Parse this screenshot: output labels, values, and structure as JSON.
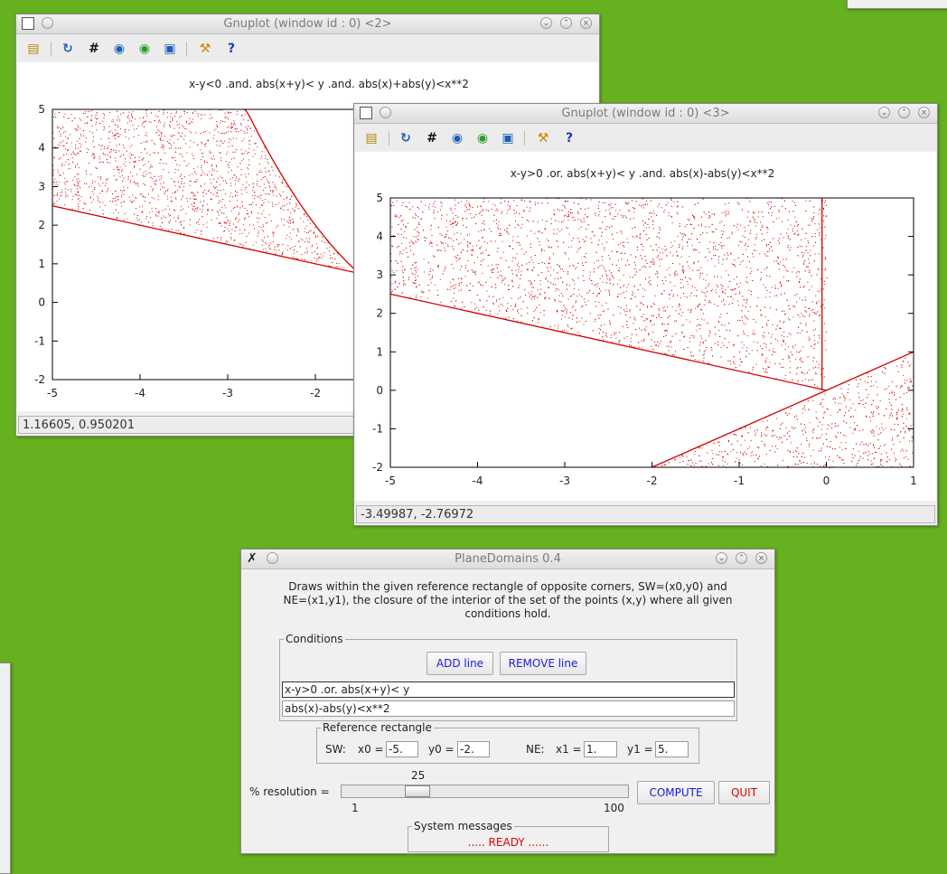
{
  "window1": {
    "title": "Gnuplot (window id : 0) <2>",
    "plot_title": "x-y<0 .and. abs(x+y)< y .and. abs(x)+abs(y)<x**2",
    "status": "1.16605,  0.950201",
    "icons": [
      "copy-to-clipboard-icon",
      "replot-icon",
      "grid-icon",
      "zoom-prev-icon",
      "zoom-next-icon",
      "autoscale-icon",
      "config-icon",
      "help-icon"
    ]
  },
  "window2": {
    "title": "Gnuplot (window id : 0) <3>",
    "plot_title": "x-y>0 .or. abs(x+y)< y .and. abs(x)-abs(y)<x**2",
    "status": "-3.49987, -2.76972"
  },
  "chart_data": [
    {
      "type": "scatter",
      "title": "x-y<0 .and. abs(x+y)< y .and. abs(x)+abs(y)<x**2",
      "xlim": [
        -5,
        1
      ],
      "ylim": [
        -2,
        5
      ],
      "x_ticks_visible": [
        "-5",
        "-4",
        "-3",
        "-2"
      ],
      "y_ticks": [
        "5",
        "4",
        "3",
        "2",
        "1",
        "0",
        "-1",
        "-2"
      ],
      "color": "#d40000",
      "region": "y > -x/3 + 2.5/3*... bounded above by curve; filled random points",
      "series": [
        {
          "values": []
        }
      ]
    },
    {
      "type": "scatter",
      "title": "x-y>0 .or. abs(x+y)< y .and. abs(x)-abs(y)<x**2",
      "xlim": [
        -5,
        1
      ],
      "ylim": [
        -2,
        5
      ],
      "x_ticks": [
        "-5",
        "-4",
        "-3",
        "-2",
        "-1",
        "0",
        "1"
      ],
      "y_ticks": [
        "5",
        "4",
        "3",
        "2",
        "1",
        "0",
        "-1",
        "-2"
      ],
      "color": "#d40000"
    }
  ],
  "planedomains": {
    "title": "PlaneDomains 0.4",
    "description": [
      "Draws within the given reference rectangle of opposite corners,  SW=(x0,y0) and",
      "NE=(x1,y1), the closure of the interior of the set of the points (x,y) where all given",
      "conditions hold."
    ],
    "conditions_label": "Conditions",
    "add_line": "ADD line",
    "remove_line": "REMOVE line",
    "condition1": "x-y>0 .or. abs(x+y)< y",
    "condition2": "abs(x)-abs(y)<x**2",
    "ref_label": "Reference rectangle",
    "sw_label": "SW:",
    "x0_label": "x0 =",
    "x0": "-5.",
    "y0_label": "y0 =",
    "y0": "-2.",
    "ne_label": "NE:",
    "x1_label": "x1 =",
    "x1": "1.",
    "y1_label": "y1 =",
    "y1": "5.",
    "resolution_label": "% resolution =",
    "resolution_value": "25",
    "resolution": 25,
    "res_min": "1",
    "res_max": "100",
    "compute": "COMPUTE",
    "quit": "QUIT",
    "messages_label": "System messages",
    "message": ".....  READY  ......"
  }
}
